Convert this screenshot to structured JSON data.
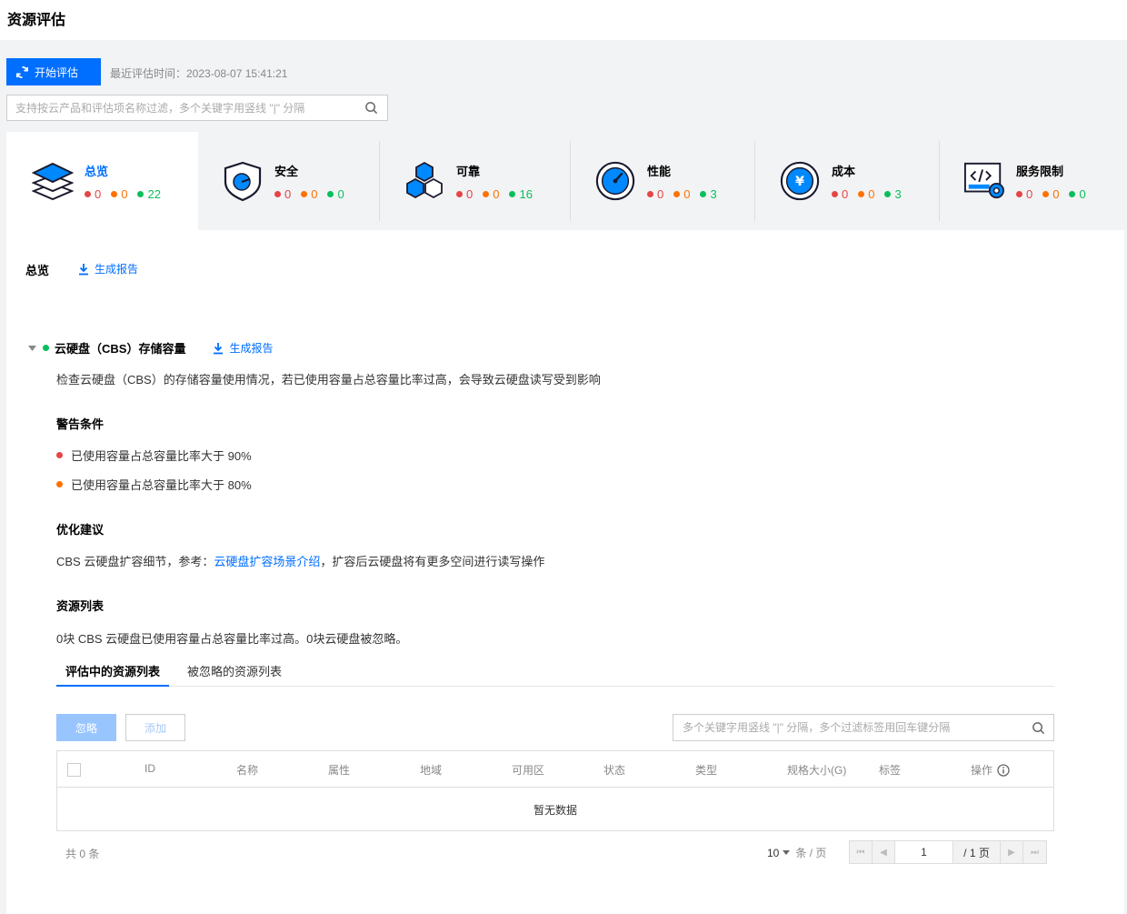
{
  "page": {
    "title": "资源评估"
  },
  "toolbar": {
    "start_label": "开始评估",
    "last_time": "最近评估时间：2023-08-07 15:41:21"
  },
  "search": {
    "placeholder": "支持按云产品和评估项名称过滤，多个关键字用竖线 \"|\" 分隔"
  },
  "categories": [
    {
      "name": "总览",
      "red": "0",
      "orange": "0",
      "green": "22",
      "icon": "layers-icon"
    },
    {
      "name": "安全",
      "red": "0",
      "orange": "0",
      "green": "0",
      "icon": "shield-icon"
    },
    {
      "name": "可靠",
      "red": "0",
      "orange": "0",
      "green": "16",
      "icon": "cubes-icon"
    },
    {
      "name": "性能",
      "red": "0",
      "orange": "0",
      "green": "3",
      "icon": "gauge-icon"
    },
    {
      "name": "成本",
      "red": "0",
      "orange": "0",
      "green": "3",
      "icon": "yen-icon"
    },
    {
      "name": "服务限制",
      "red": "0",
      "orange": "0",
      "green": "0",
      "icon": "code-gear-icon"
    }
  ],
  "overview": {
    "title": "总览",
    "report_label": "生成报告"
  },
  "item": {
    "title": "云硬盘（CBS）存储容量",
    "report_label": "生成报告",
    "description": "检查云硬盘（CBS）的存储容量使用情况，若已使用容量占总容量比率过高，会导致云硬盘读写受到影响",
    "warning_title": "警告条件",
    "conditions": [
      "已使用容量占总容量比率大于 90%",
      "已使用容量占总容量比率大于 80%"
    ],
    "advice_title": "优化建议",
    "advice_prefix": "CBS 云硬盘扩容细节，参考：",
    "advice_link": "云硬盘扩容场景介绍",
    "advice_suffix": "，扩容后云硬盘将有更多空间进行读写操作",
    "resources_title": "资源列表",
    "resources_summary": "0块 CBS 云硬盘已使用容量占总容量比率过高。0块云硬盘被忽略。"
  },
  "tabs": [
    "评估中的资源列表",
    "被忽略的资源列表"
  ],
  "table": {
    "ignore_label": "忽略",
    "add_label": "添加",
    "search_placeholder": "多个关键字用竖线 \"|\" 分隔，多个过滤标签用回车键分隔",
    "columns": [
      "ID",
      "名称",
      "属性",
      "地域",
      "可用区",
      "状态",
      "类型",
      "规格大小(G)",
      "标签",
      "操作"
    ],
    "empty": "暂无数据",
    "total": "共 0 条",
    "page_size": "10",
    "page_size_unit": "条 / 页",
    "page": "1",
    "page_total": "/ 1 页"
  },
  "colors": {
    "accent": "#006eff",
    "red": "#e54545",
    "orange": "#ff7200",
    "green": "#0abf5b"
  }
}
